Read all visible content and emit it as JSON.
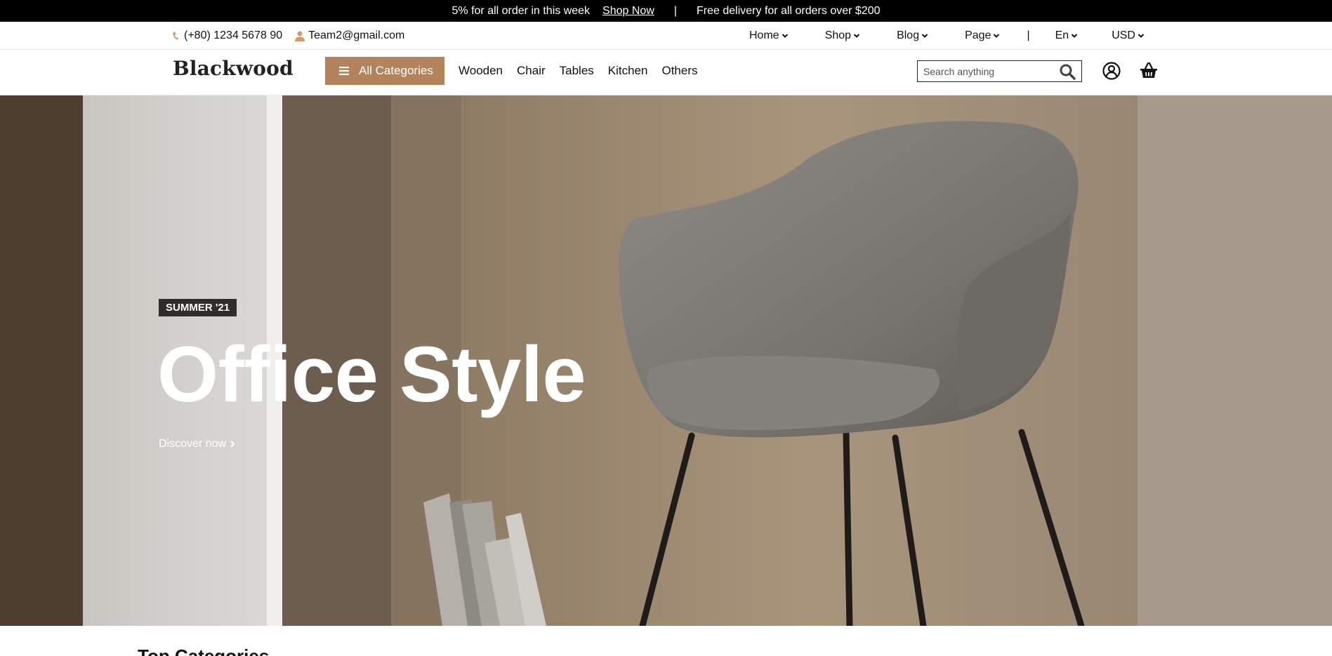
{
  "announcement": {
    "offer_text": "5% for all order in this week",
    "shop_link": "Shop Now",
    "separator": "|",
    "delivery_text": "Free delivery for all orders over $200"
  },
  "utility": {
    "phone": "(+80) 1234 5678 90",
    "email": "Team2@gmail.com",
    "menus": [
      "Home",
      "Shop",
      "Blog",
      "Page"
    ],
    "divider": "|",
    "language": "En",
    "currency": "USD"
  },
  "header": {
    "logo": "Blackwood",
    "all_categories": "All Categories",
    "categories": [
      "Wooden",
      "Chair",
      "Tables",
      "Kitchen",
      "Others"
    ],
    "search_placeholder": "Search anything"
  },
  "hero": {
    "badge": "SUMMER '21",
    "title": "Office Style",
    "cta": "Discover now"
  },
  "section": {
    "title": "Top Categories"
  },
  "colors": {
    "accent": "#b3835b",
    "announcement_bg": "#000000",
    "badge_bg": "#2f2c29"
  },
  "icons": [
    "phone-icon",
    "user-icon",
    "chevron-down-icon",
    "menu-icon",
    "search-icon",
    "account-icon",
    "basket-icon",
    "chevron-right-icon"
  ]
}
